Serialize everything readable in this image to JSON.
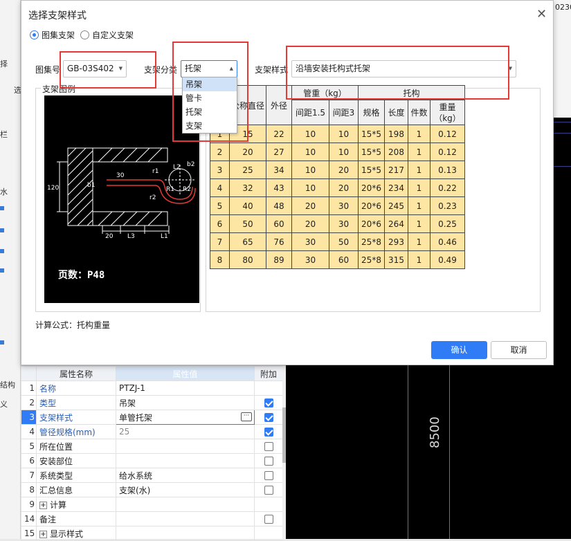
{
  "background_app": {
    "left_labels": [
      "择",
      "选",
      "栏",
      "水",
      "结构",
      "义"
    ],
    "top_right_fragment": "0230",
    "cad_label": "8500"
  },
  "dialog": {
    "title": "选择支架样式",
    "radio_atlas": "图集支架",
    "radio_custom": "自定义支架",
    "atlas_no_label": "图集号",
    "atlas_no_value": "GB-03S402",
    "category_label": "支架分类",
    "category_value": "托架",
    "category_options": [
      "吊架",
      "管卡",
      "托架",
      "支架"
    ],
    "style_label": "支架样式",
    "style_value": "沿墙安装托构式托架",
    "example_legend": "支架图例",
    "drawing_page": "页数：P48",
    "drawing_labels": [
      "120",
      "b1",
      "30",
      "r1",
      "r2",
      "L2",
      "b2",
      "R1",
      "R2",
      "20",
      "L3",
      "L1"
    ],
    "formula": "计算公式：托构重量",
    "ok_button": "确认",
    "cancel_button": "取消",
    "spec_table": {
      "header_nominal": "公称直径",
      "header_outer": "外径",
      "header_pipe_weight": "管重（kg）",
      "header_bracket": "托构",
      "header_span15": "间距1.5",
      "header_span3": "间距3",
      "header_spec": "规格",
      "header_length": "长度",
      "header_count": "件数",
      "header_weight": "重量（kg）",
      "rows": [
        [
          "1",
          "15",
          "22",
          "10",
          "10",
          "15*5",
          "198",
          "1",
          "0.12"
        ],
        [
          "2",
          "20",
          "27",
          "10",
          "10",
          "15*5",
          "208",
          "1",
          "0.12"
        ],
        [
          "3",
          "25",
          "34",
          "10",
          "20",
          "15*5",
          "217",
          "1",
          "0.13"
        ],
        [
          "4",
          "32",
          "43",
          "10",
          "20",
          "20*6",
          "234",
          "1",
          "0.22"
        ],
        [
          "5",
          "40",
          "48",
          "20",
          "30",
          "20*6",
          "245",
          "1",
          "0.23"
        ],
        [
          "6",
          "50",
          "60",
          "20",
          "30",
          "20*6",
          "264",
          "1",
          "0.25"
        ],
        [
          "7",
          "65",
          "76",
          "30",
          "50",
          "25*8",
          "293",
          "1",
          "0.46"
        ],
        [
          "8",
          "80",
          "89",
          "30",
          "60",
          "25*8",
          "315",
          "1",
          "0.49"
        ]
      ]
    }
  },
  "props": {
    "head_name": "属性名称",
    "head_value": "属性值",
    "head_extra": "附加",
    "rows": [
      {
        "num": "1",
        "name": "名称",
        "value": "PTZJ-1"
      },
      {
        "num": "2",
        "name": "类型",
        "value": "吊架"
      },
      {
        "num": "3",
        "name": "支架样式",
        "value": "单管托架"
      },
      {
        "num": "4",
        "name": "管径规格(mm)",
        "value": "25"
      },
      {
        "num": "5",
        "name": "所在位置",
        "value": ""
      },
      {
        "num": "6",
        "name": "安装部位",
        "value": ""
      },
      {
        "num": "7",
        "name": "系统类型",
        "value": "给水系统"
      },
      {
        "num": "8",
        "name": "汇总信息",
        "value": "支架(水)"
      },
      {
        "num": "9",
        "name": "计算",
        "value": ""
      },
      {
        "num": "14",
        "name": "备注",
        "value": ""
      },
      {
        "num": "15",
        "name": "显示样式",
        "value": ""
      }
    ]
  },
  "colors": {
    "accent": "#2f7cf6",
    "highlight_box": "#e53935",
    "table_fill": "#fde5a3",
    "cad_green": "#1fae1f"
  }
}
